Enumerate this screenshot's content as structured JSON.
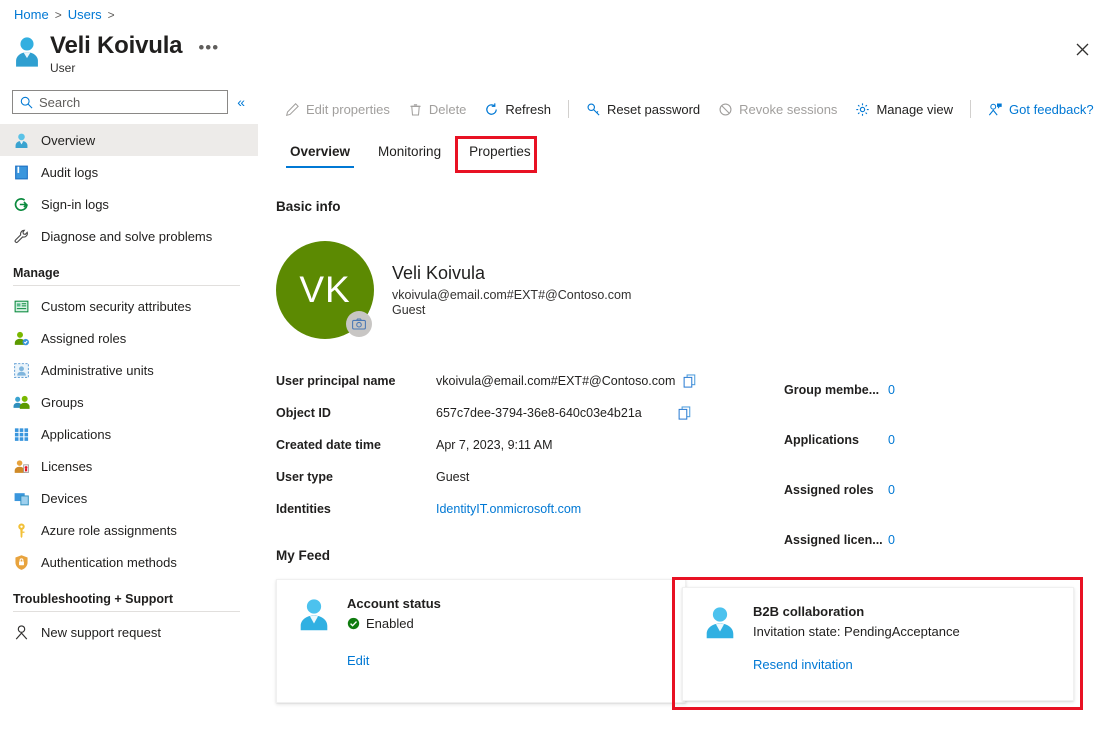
{
  "breadcrumb": {
    "items": [
      "Home",
      "Users"
    ],
    "separator": ">"
  },
  "header": {
    "title": "Veli Koivula",
    "subtitle": "User",
    "ellipsis": "•••",
    "close_icon": "close-icon"
  },
  "sidebar": {
    "search": {
      "placeholder": "Search",
      "value": ""
    },
    "collapse_label": "«",
    "items": [
      {
        "label": "Overview",
        "icon": "user-icon",
        "selected": true
      },
      {
        "label": "Audit logs",
        "icon": "book-icon",
        "selected": false
      },
      {
        "label": "Sign-in logs",
        "icon": "signin-icon",
        "selected": false
      },
      {
        "label": "Diagnose and solve problems",
        "icon": "wrench-icon",
        "selected": false
      }
    ],
    "sections": [
      {
        "title": "Manage",
        "items": [
          {
            "label": "Custom security attributes",
            "icon": "attributes-icon"
          },
          {
            "label": "Assigned roles",
            "icon": "assigned-roles-icon"
          },
          {
            "label": "Administrative units",
            "icon": "admin-units-icon"
          },
          {
            "label": "Groups",
            "icon": "groups-icon"
          },
          {
            "label": "Applications",
            "icon": "applications-grid-icon"
          },
          {
            "label": "Licenses",
            "icon": "license-icon"
          },
          {
            "label": "Devices",
            "icon": "devices-icon"
          },
          {
            "label": "Azure role assignments",
            "icon": "key-icon"
          },
          {
            "label": "Authentication methods",
            "icon": "shield-lock-icon"
          }
        ]
      },
      {
        "title": "Troubleshooting + Support",
        "items": [
          {
            "label": "New support request",
            "icon": "support-person-icon"
          }
        ]
      }
    ]
  },
  "toolbar": {
    "commands": [
      {
        "label": "Edit properties",
        "icon": "pencil-icon",
        "disabled": true
      },
      {
        "label": "Delete",
        "icon": "trash-icon",
        "disabled": true
      },
      {
        "label": "Refresh",
        "icon": "refresh-icon",
        "disabled": false
      },
      {
        "label": "Reset password",
        "icon": "key-icon",
        "disabled": false
      },
      {
        "label": "Revoke sessions",
        "icon": "block-icon",
        "disabled": true
      },
      {
        "label": "Manage view",
        "icon": "gear-icon",
        "disabled": false
      },
      {
        "label": "Got feedback?",
        "icon": "feedback-person-icon",
        "disabled": false
      }
    ]
  },
  "tabs": [
    {
      "label": "Overview",
      "active": true
    },
    {
      "label": "Monitoring",
      "active": false
    },
    {
      "label": "Properties",
      "active": false,
      "annotated": true
    }
  ],
  "basic_info": {
    "heading": "Basic info",
    "avatar": {
      "initials": "VK",
      "color": "#5c8a02",
      "camera_icon": "camera-icon"
    },
    "name": "Veli Koivula",
    "upn": "vkoivula@email.com#EXT#@Contoso.com",
    "user_type": "Guest",
    "properties": [
      {
        "label": "User principal name",
        "value": "vkoivula@email.com#EXT#@Contoso.com",
        "copy": true,
        "link": false
      },
      {
        "label": "Object ID",
        "value": "657c7dee-3794-36e8-640c03e4b21a",
        "copy": true,
        "link": false
      },
      {
        "label": "Created date time",
        "value": "Apr 7, 2023, 9:11 AM",
        "copy": false,
        "link": false
      },
      {
        "label": "User type",
        "value": "Guest",
        "copy": false,
        "link": false
      },
      {
        "label": "Identities",
        "value": "IdentityIT.onmicrosoft.com",
        "copy": false,
        "link": true
      }
    ],
    "counts": [
      {
        "label": "Group membe...",
        "value": "0"
      },
      {
        "label": "Applications",
        "value": "0"
      },
      {
        "label": "Assigned roles",
        "value": "0"
      },
      {
        "label": "Assigned licen...",
        "value": "0"
      }
    ]
  },
  "my_feed": {
    "heading": "My Feed",
    "account_status_card": {
      "title": "Account status",
      "status": "Enabled",
      "status_icon": "check-circle-icon",
      "link": "Edit"
    },
    "b2b_card": {
      "title": "B2B collaboration",
      "status": "Invitation state: PendingAcceptance",
      "link": "Resend invitation"
    }
  },
  "colors": {
    "accent": "#0078d4",
    "annotation": "#e81123",
    "avatar_green": "#5c8a02",
    "status_green": "#107c10",
    "icon_cyan": "#32afe0"
  }
}
